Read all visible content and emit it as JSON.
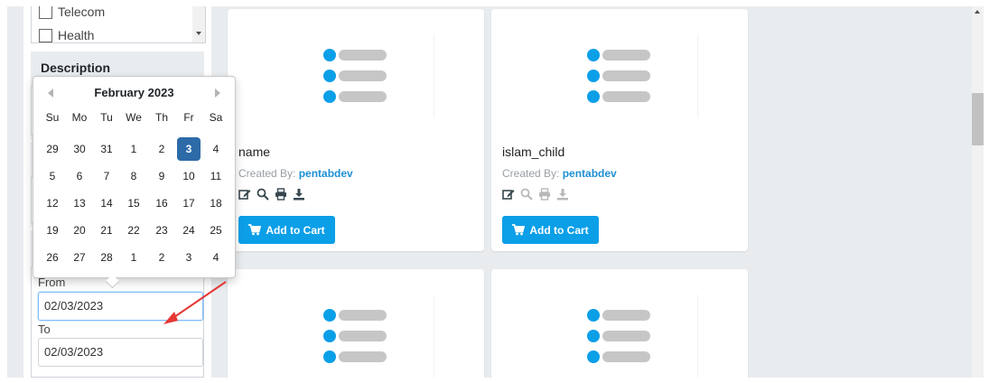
{
  "sidebar": {
    "categories": [
      {
        "label": "Telecom"
      },
      {
        "label": "Health"
      }
    ],
    "description_title": "Description",
    "date_filter": {
      "from_label": "From",
      "from_value": "02/03/2023",
      "to_label": "To",
      "to_value": "02/03/2023"
    }
  },
  "datepicker": {
    "month_title": "February 2023",
    "weekdays": [
      "Su",
      "Mo",
      "Tu",
      "We",
      "Th",
      "Fr",
      "Sa"
    ],
    "weeks": [
      [
        "29",
        "30",
        "31",
        "1",
        "2",
        "3",
        "4"
      ],
      [
        "5",
        "6",
        "7",
        "8",
        "9",
        "10",
        "11"
      ],
      [
        "12",
        "13",
        "14",
        "15",
        "16",
        "17",
        "18"
      ],
      [
        "19",
        "20",
        "21",
        "22",
        "23",
        "24",
        "25"
      ],
      [
        "26",
        "27",
        "28",
        "1",
        "2",
        "3",
        "4"
      ]
    ],
    "selected_day": "3"
  },
  "cards": [
    {
      "title": "name",
      "created_by_label": "Created By:",
      "author": "pentabdev",
      "icons": [
        "edit-icon",
        "search-icon",
        "print-icon",
        "download-icon"
      ],
      "add_to_cart_label": "Add to Cart"
    },
    {
      "title": "islam_child",
      "created_by_label": "Created By:",
      "author": "pentabdev",
      "icons": [
        "edit-icon",
        "search-icon",
        "print-icon",
        "download-icon"
      ],
      "add_to_cart_label": "Add to Cart"
    }
  ],
  "colors": {
    "accent": "#0b9fe8",
    "selected_day": "#2d6aa8",
    "annotation_arrow": "#e53935"
  }
}
